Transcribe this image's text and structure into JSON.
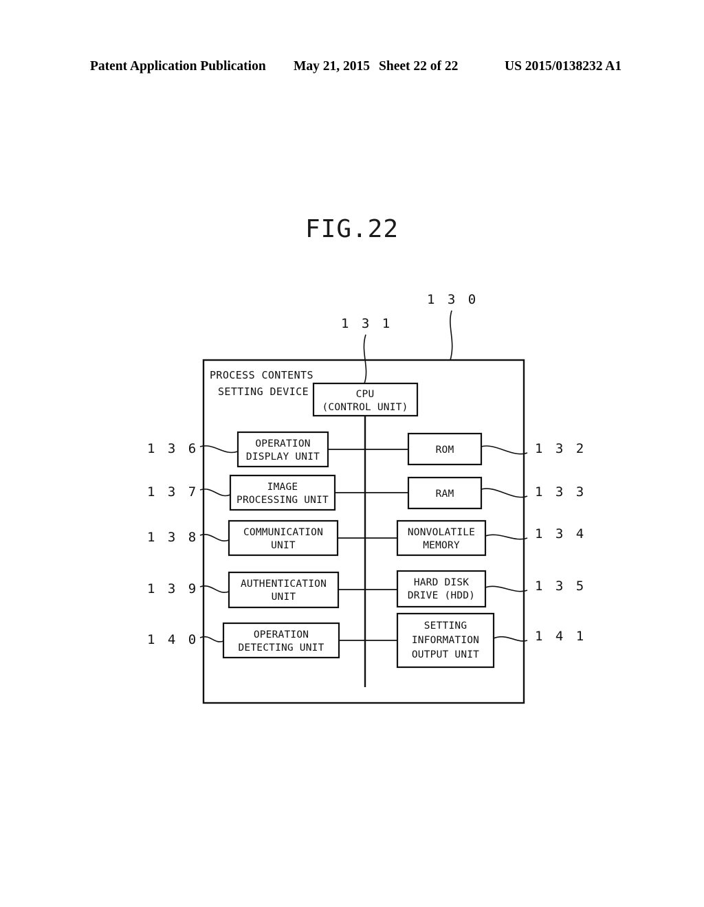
{
  "page_header": {
    "publication": "Patent Application Publication",
    "date": "May 21, 2015",
    "sheet": "Sheet 22 of 22",
    "document_number": "US 2015/0138232 A1"
  },
  "figure": {
    "title": "FIG.22",
    "device_title_line1": "PROCESS CONTENTS",
    "device_title_line2": "SETTING DEVICE",
    "outer_ref": "1 3 0",
    "cpu": {
      "ref": "1 3 1",
      "line1": "CPU",
      "line2": "(CONTROL UNIT)"
    },
    "left_blocks": [
      {
        "ref": "1 3 6",
        "line1": "OPERATION",
        "line2": "DISPLAY UNIT"
      },
      {
        "ref": "1 3 7",
        "line1": "IMAGE",
        "line2": "PROCESSING UNIT"
      },
      {
        "ref": "1 3 8",
        "line1": "COMMUNICATION",
        "line2": "UNIT"
      },
      {
        "ref": "1 3 9",
        "line1": "AUTHENTICATION",
        "line2": "UNIT"
      },
      {
        "ref": "1 4 0",
        "line1": "OPERATION",
        "line2": "DETECTING UNIT"
      }
    ],
    "right_blocks": [
      {
        "ref": "1 3 2",
        "line1": "ROM",
        "line2": "",
        "line3": ""
      },
      {
        "ref": "1 3 3",
        "line1": "RAM",
        "line2": "",
        "line3": ""
      },
      {
        "ref": "1 3 4",
        "line1": "NONVOLATILE",
        "line2": "MEMORY",
        "line3": ""
      },
      {
        "ref": "1 3 5",
        "line1": "HARD DISK",
        "line2": "DRIVE (HDD)",
        "line3": ""
      },
      {
        "ref": "1 4 1",
        "line1": "SETTING",
        "line2": "INFORMATION",
        "line3": "OUTPUT UNIT"
      }
    ],
    "colors": {
      "line": "#111111",
      "background": "#ffffff"
    }
  }
}
